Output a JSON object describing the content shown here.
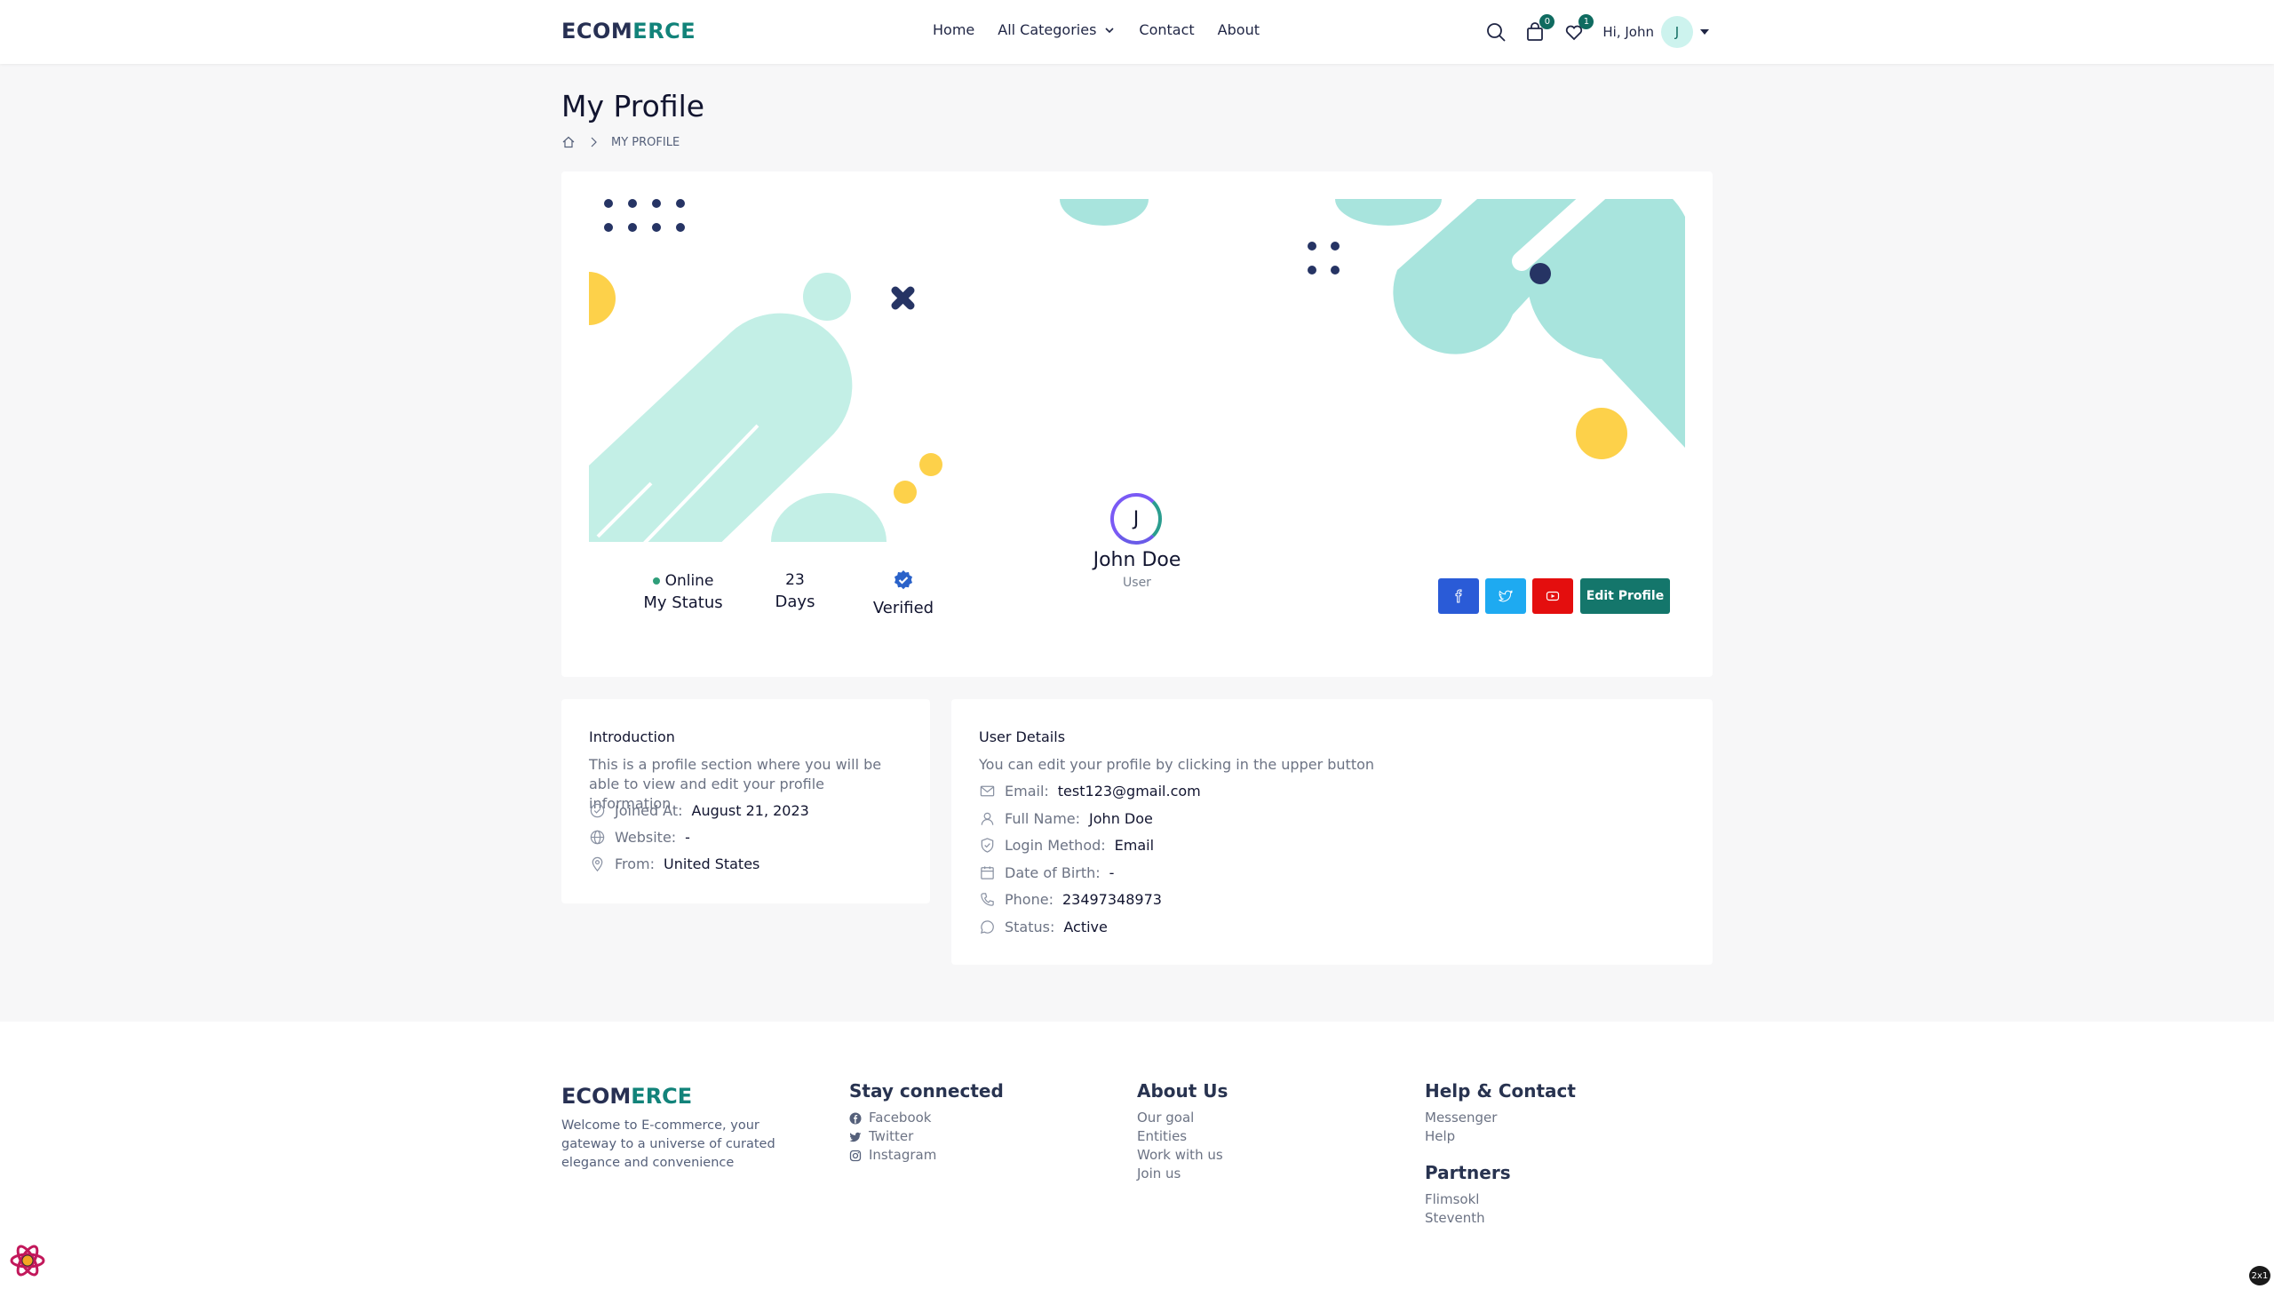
{
  "brand": {
    "logo_part1": "ECOM",
    "logo_part2": "ERCE",
    "accent_color": "#12837a"
  },
  "nav": {
    "home": "Home",
    "categories": "All Categories",
    "contact": "Contact",
    "about": "About"
  },
  "header": {
    "cart_count": "0",
    "wishlist_count": "1",
    "greeting": "Hi, John",
    "avatar_initial": "J"
  },
  "page": {
    "title": "My Profile",
    "breadcrumb": "MY PROFILE"
  },
  "profile": {
    "initial": "J",
    "name": "John Doe",
    "role": "User",
    "status_value": "Online",
    "status_label": "My Status",
    "days_value": "23",
    "days_label": "Days",
    "verified_label": "Verified",
    "edit_label": "Edit Profile",
    "social": [
      "facebook-icon",
      "twitter-icon",
      "youtube-icon"
    ]
  },
  "intro": {
    "title": "Introduction",
    "desc": "This is a profile section where you will be able to view and edit your profile information",
    "joined_label": "Joined At:",
    "joined_value": "August 21, 2023",
    "website_label": "Website:",
    "website_value": "-",
    "from_label": "From:",
    "from_value": "United States"
  },
  "details": {
    "title": "User Details",
    "desc": "You can edit your profile by clicking in the upper button",
    "email_label": "Email:",
    "email_value": "test123@gmail.com",
    "fullname_label": "Full Name:",
    "fullname_value": "John Doe",
    "login_label": "Login Method:",
    "login_value": "Email",
    "dob_label": "Date of Birth:",
    "dob_value": "-",
    "phone_label": "Phone:",
    "phone_value": "23497348973",
    "status_label": "Status:",
    "status_value": "Active"
  },
  "footer": {
    "logo_part1": "ECOM",
    "logo_part2": "ERCE",
    "desc": "Welcome to E-commerce, your gateway to a universe of curated elegance and convenience",
    "stay_title": "Stay connected",
    "stay_links": [
      "Facebook",
      "Twitter",
      "Instagram"
    ],
    "about_title": "About Us",
    "about_links": [
      "Our goal",
      "Entities",
      "Work with us",
      "Join us"
    ],
    "help_title": "Help & Contact",
    "help_links": [
      "Messenger",
      "Help"
    ],
    "partners_title": "Partners",
    "partners_links": [
      "Flimsokl",
      "Steventh"
    ]
  },
  "corner_badge": "2x1"
}
